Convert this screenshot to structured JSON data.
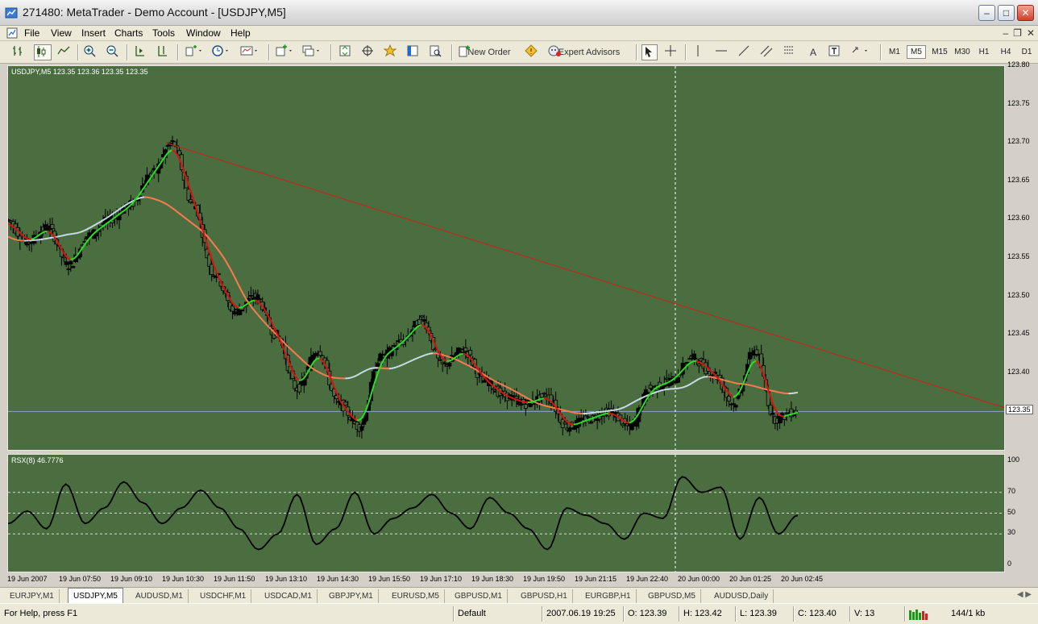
{
  "window": {
    "title": "271480: MetaTrader - Demo Account - [USDJPY,M5]"
  },
  "menu": {
    "items": [
      "File",
      "View",
      "Insert",
      "Charts",
      "Tools",
      "Window",
      "Help"
    ]
  },
  "toolbar": {
    "new_order_label": "New Order",
    "expert_advisors_label": "Expert Advisors",
    "text_tool_label": "A",
    "timeframes": [
      "M1",
      "M5",
      "M15",
      "M30",
      "H1",
      "H4",
      "D1"
    ],
    "active_timeframe": "M5"
  },
  "chart": {
    "price_label": "USDJPY,M5  123.35 123.36 123.35 123.35",
    "indicator_label": "RSX(8) 46.7776",
    "current_price": "123.35",
    "price_ticks": [
      "123.80",
      "123.75",
      "123.70",
      "123.65",
      "123.60",
      "123.55",
      "123.50",
      "123.45",
      "123.40",
      "123.35"
    ],
    "indicator_ticks": [
      "100",
      "70",
      "50",
      "30",
      "0"
    ],
    "time_ticks": [
      "19 Jun 2007",
      "19 Jun 07:50",
      "19 Jun 09:10",
      "19 Jun 10:30",
      "19 Jun 11:50",
      "19 Jun 13:10",
      "19 Jun 14:30",
      "19 Jun 15:50",
      "19 Jun 17:10",
      "19 Jun 18:30",
      "19 Jun 19:50",
      "19 Jun 21:15",
      "19 Jun 22:40",
      "20 Jun 00:00",
      "20 Jun 01:25",
      "20 Jun 02:45"
    ],
    "colors": {
      "background": "#4a6e40",
      "trendline": "#c0281c",
      "slow_ma": "#ff7a50",
      "base_ma": "#c8dcea",
      "fast_up": "#26e426",
      "fast_down": "#e01010",
      "rsx_line": "#000000"
    }
  },
  "chart_data": [
    {
      "type": "line",
      "title": "USDJPY,M5",
      "ylim": [
        123.3,
        123.8
      ],
      "current_price": 123.35,
      "trendline": [
        {
          "time": "19 Jun 10:30",
          "price": 123.7
        },
        {
          "time": "20 Jun 02:45",
          "price": 123.44
        }
      ],
      "series": [
        {
          "name": "",
          "values": [
            123.6,
            123.57,
            123.59,
            123.54,
            123.58,
            123.6,
            123.62,
            123.66,
            123.7,
            123.62,
            123.53,
            123.48,
            123.5,
            123.45,
            123.38,
            123.43,
            123.36,
            123.33,
            123.42,
            123.44,
            123.47,
            123.41,
            123.43,
            123.39,
            123.37,
            123.36,
            123.37,
            123.33,
            123.34,
            123.35,
            123.33,
            123.38,
            123.39,
            123.42,
            123.4,
            123.36,
            123.43,
            123.34,
            123.35
          ]
        }
      ]
    },
    {
      "type": "line",
      "title": "RSX(8)",
      "ylim": [
        0,
        100
      ],
      "levels": [
        30,
        50,
        70
      ],
      "last_value": 46.7776,
      "series": [
        {
          "name": "RSX(8)",
          "values": [
            40,
            52,
            35,
            78,
            40,
            55,
            80,
            60,
            40,
            55,
            72,
            55,
            35,
            15,
            30,
            68,
            20,
            35,
            70,
            30,
            45,
            55,
            68,
            50,
            35,
            65,
            50,
            35,
            15,
            55,
            48,
            40,
            25,
            50,
            45,
            85,
            70,
            75,
            25,
            65,
            30,
            48
          ]
        }
      ]
    }
  ],
  "tabs": [
    "EURJPY,M1",
    "USDJPY,M5",
    "AUDUSD,M1",
    "USDCHF,M1",
    "USDCAD,M1",
    "GBPJPY,M1",
    "EURUSD,M5",
    "GBPUSD,M1",
    "GBPUSD,H1",
    "EURGBP,H1",
    "GBPUSD,M5",
    "AUDUSD,Daily"
  ],
  "active_tab": "USDJPY,M5",
  "status": {
    "help": "For Help, press F1",
    "profile": "Default",
    "datetime": "2007.06.19 19:25",
    "open": "O: 123.39",
    "high": "H: 123.42",
    "low": "L: 123.39",
    "close": "C: 123.40",
    "volume": "V: 13",
    "traffic": "144/1 kb"
  }
}
